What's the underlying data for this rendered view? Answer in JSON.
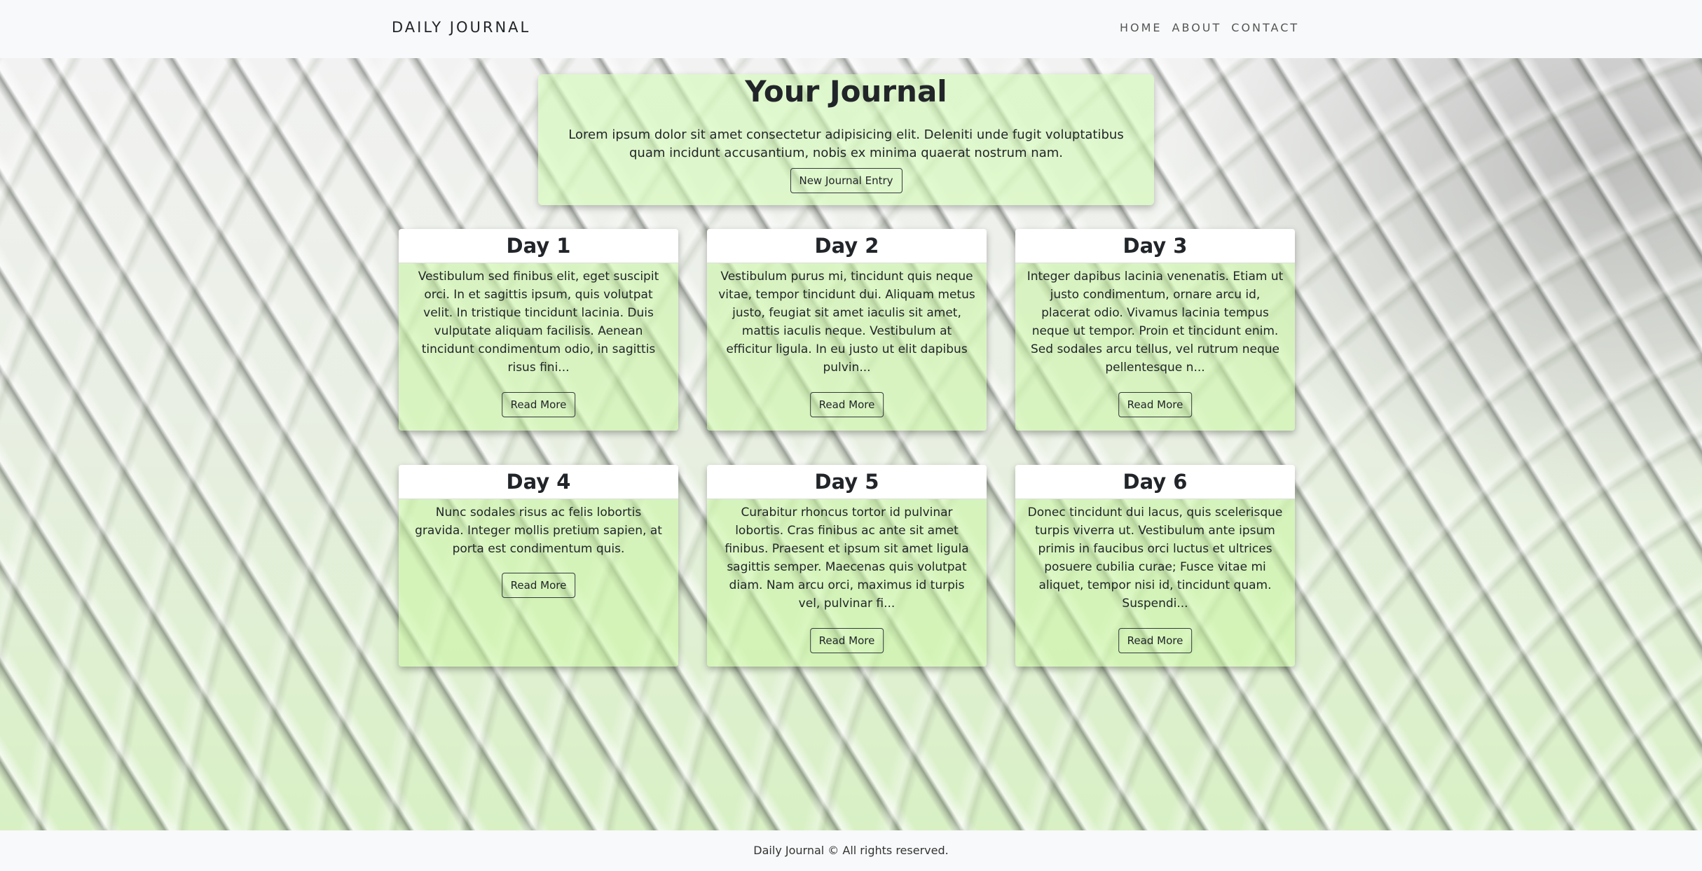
{
  "navbar": {
    "brand": "DAILY JOURNAL",
    "links": [
      "HOME",
      "ABOUT",
      "CONTACT"
    ]
  },
  "hero": {
    "title": "Your Journal",
    "text": "Lorem ipsum dolor sit amet consectetur adipisicing elit. Deleniti unde fugit voluptatibus quam incidunt accusantium, nobis ex minima quaerat nostrum nam.",
    "button": "New Journal Entry"
  },
  "cards": [
    {
      "title": "Day 1",
      "text": "Vestibulum sed finibus elit, eget suscipit orci. In et sagittis ipsum, quis volutpat velit. In tristique tincidunt lacinia. Duis vulputate aliquam facilisis. Aenean tincidunt condimentum odio, in sagittis risus fini...",
      "button": "Read More"
    },
    {
      "title": "Day 2",
      "text": "Vestibulum purus mi, tincidunt quis neque vitae, tempor tincidunt dui. Aliquam metus justo, feugiat sit amet iaculis sit amet, mattis iaculis neque. Vestibulum at efficitur ligula. In eu justo ut elit dapibus pulvin...",
      "button": "Read More"
    },
    {
      "title": "Day 3",
      "text": "Integer dapibus lacinia venenatis. Etiam ut justo condimentum, ornare arcu id, placerat odio. Vivamus lacinia tempus neque ut tempor. Proin et tincidunt enim. Sed sodales arcu tellus, vel rutrum neque pellentesque n...",
      "button": "Read More"
    },
    {
      "title": "Day 4",
      "text": "Nunc sodales risus ac felis lobortis gravida. Integer mollis pretium sapien, at porta est condimentum quis.",
      "button": "Read More"
    },
    {
      "title": "Day 5",
      "text": "Curabitur rhoncus tortor id pulvinar lobortis. Cras finibus ac ante sit amet finibus. Praesent et ipsum sit amet ligula sagittis semper. Maecenas quis volutpat diam. Nam arcu orci, maximus id turpis vel, pulvinar fi...",
      "button": "Read More"
    },
    {
      "title": "Day 6",
      "text": "Donec tincidunt dui lacus, quis scelerisque turpis viverra ut. Vestibulum ante ipsum primis in faucibus orci luctus et ultrices posuere cubilia curae; Fusce vitae mi aliquet, tempor nisi id, tincidunt quam. Suspendi...",
      "button": "Read More"
    }
  ],
  "footer": {
    "text": "Daily Journal © All rights reserved."
  }
}
